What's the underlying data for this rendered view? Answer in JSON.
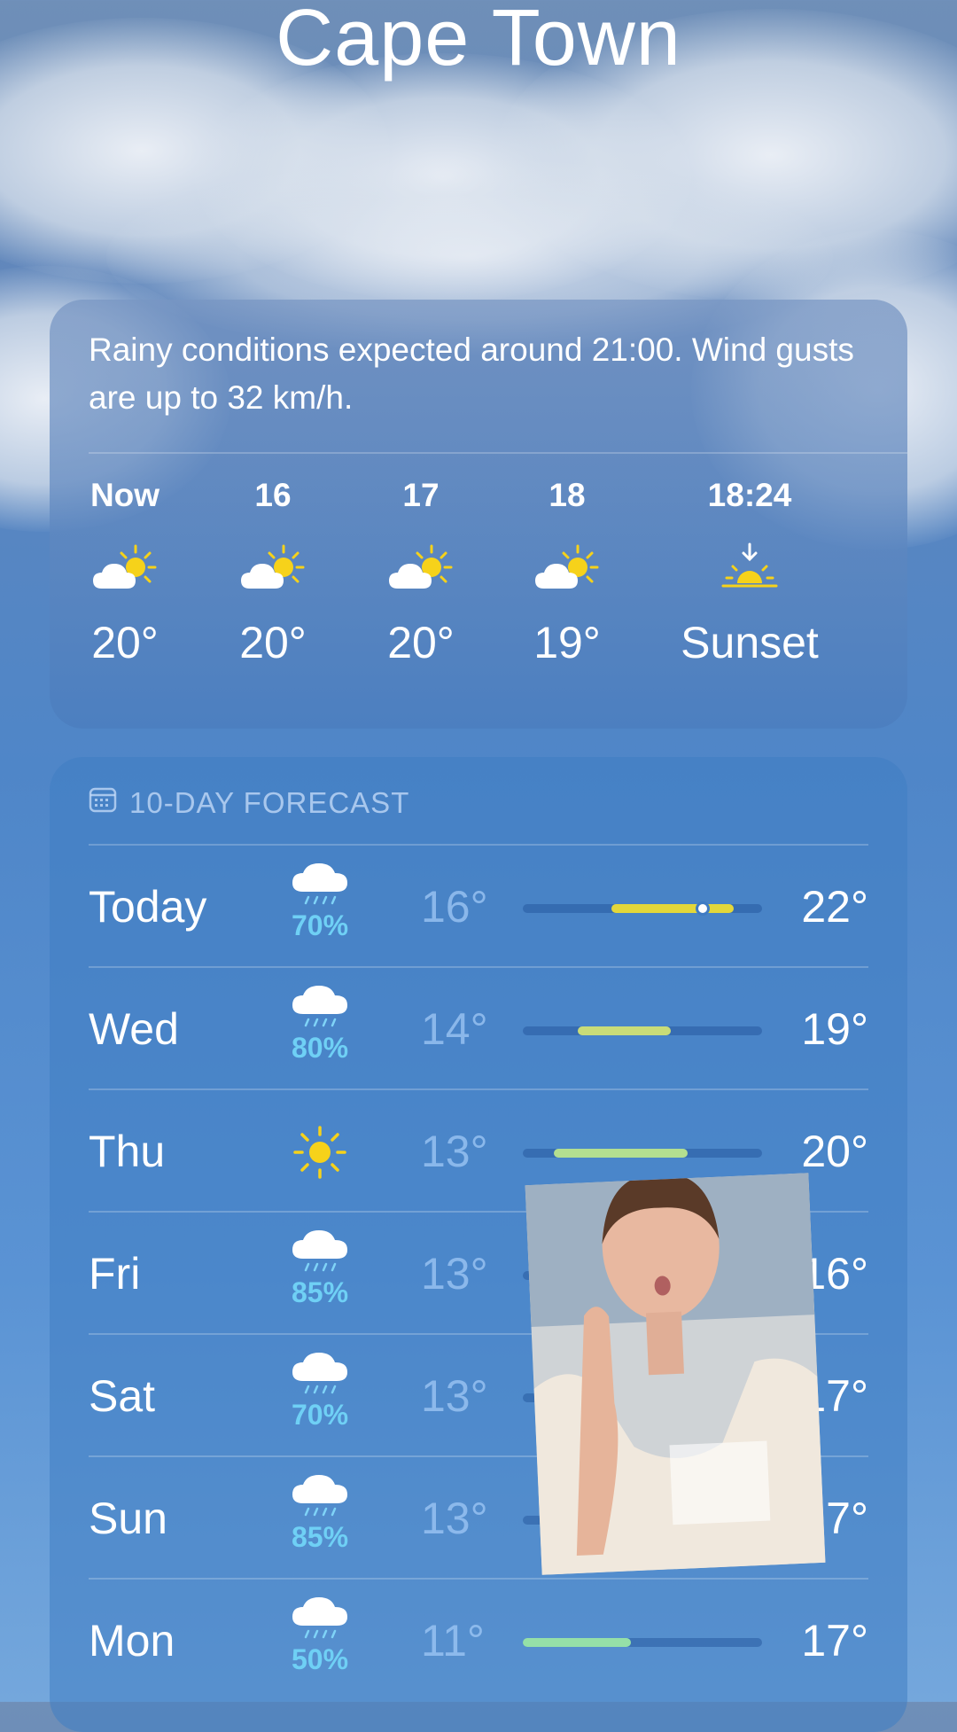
{
  "location": {
    "city": "Cape Town"
  },
  "summary": {
    "text": "Rainy conditions expected around 21:00. Wind gusts are up to 32 km/h."
  },
  "hourly": [
    {
      "label": "Now",
      "icon": "partly-cloudy-icon",
      "value": "20°"
    },
    {
      "label": "16",
      "icon": "partly-cloudy-icon",
      "value": "20°"
    },
    {
      "label": "17",
      "icon": "partly-cloudy-icon",
      "value": "20°"
    },
    {
      "label": "18",
      "icon": "partly-cloudy-icon",
      "value": "19°"
    },
    {
      "label": "18:24",
      "icon": "sunset-icon",
      "value": "Sunset"
    }
  ],
  "forecast": {
    "header": "10-DAY FORECAST",
    "days": [
      {
        "day": "Today",
        "icon": "rain-cloud-icon",
        "precip": "70%",
        "low": "16°",
        "high": "22°",
        "range_start": 0.37,
        "range_end": 0.88,
        "current_marker": 0.75,
        "bar_color": "#e3d73a"
      },
      {
        "day": "Wed",
        "icon": "rain-cloud-icon",
        "precip": "80%",
        "low": "14°",
        "high": "19°",
        "range_start": 0.23,
        "range_end": 0.62,
        "bar_color": "#c9dc78"
      },
      {
        "day": "Thu",
        "icon": "sun-icon",
        "precip": "",
        "low": "13°",
        "high": "20°",
        "range_start": 0.13,
        "range_end": 0.69,
        "bar_color": "#b3df90"
      },
      {
        "day": "Fri",
        "icon": "rain-cloud-icon",
        "precip": "85%",
        "low": "13°",
        "high": "16°",
        "range_start": 0.13,
        "range_end": 0.4,
        "bar_color": "#a6dfa0"
      },
      {
        "day": "Sat",
        "icon": "rain-cloud-icon",
        "precip": "70%",
        "low": "13°",
        "high": "17°",
        "range_start": 0.13,
        "range_end": 0.48,
        "bar_color": "#a6dfa0"
      },
      {
        "day": "Sun",
        "icon": "rain-cloud-icon",
        "precip": "85%",
        "low": "13°",
        "high": "17°",
        "range_start": 0.13,
        "range_end": 0.48,
        "bar_color": "#a6dfa0"
      },
      {
        "day": "Mon",
        "icon": "rain-cloud-icon",
        "precip": "50%",
        "low": "11°",
        "high": "17°",
        "range_start": 0.0,
        "range_end": 0.45,
        "bar_color": "#95e0a8"
      }
    ]
  },
  "colors": {
    "precip_text": "#6fd0f5",
    "sun_yellow": "#f6d21a"
  }
}
